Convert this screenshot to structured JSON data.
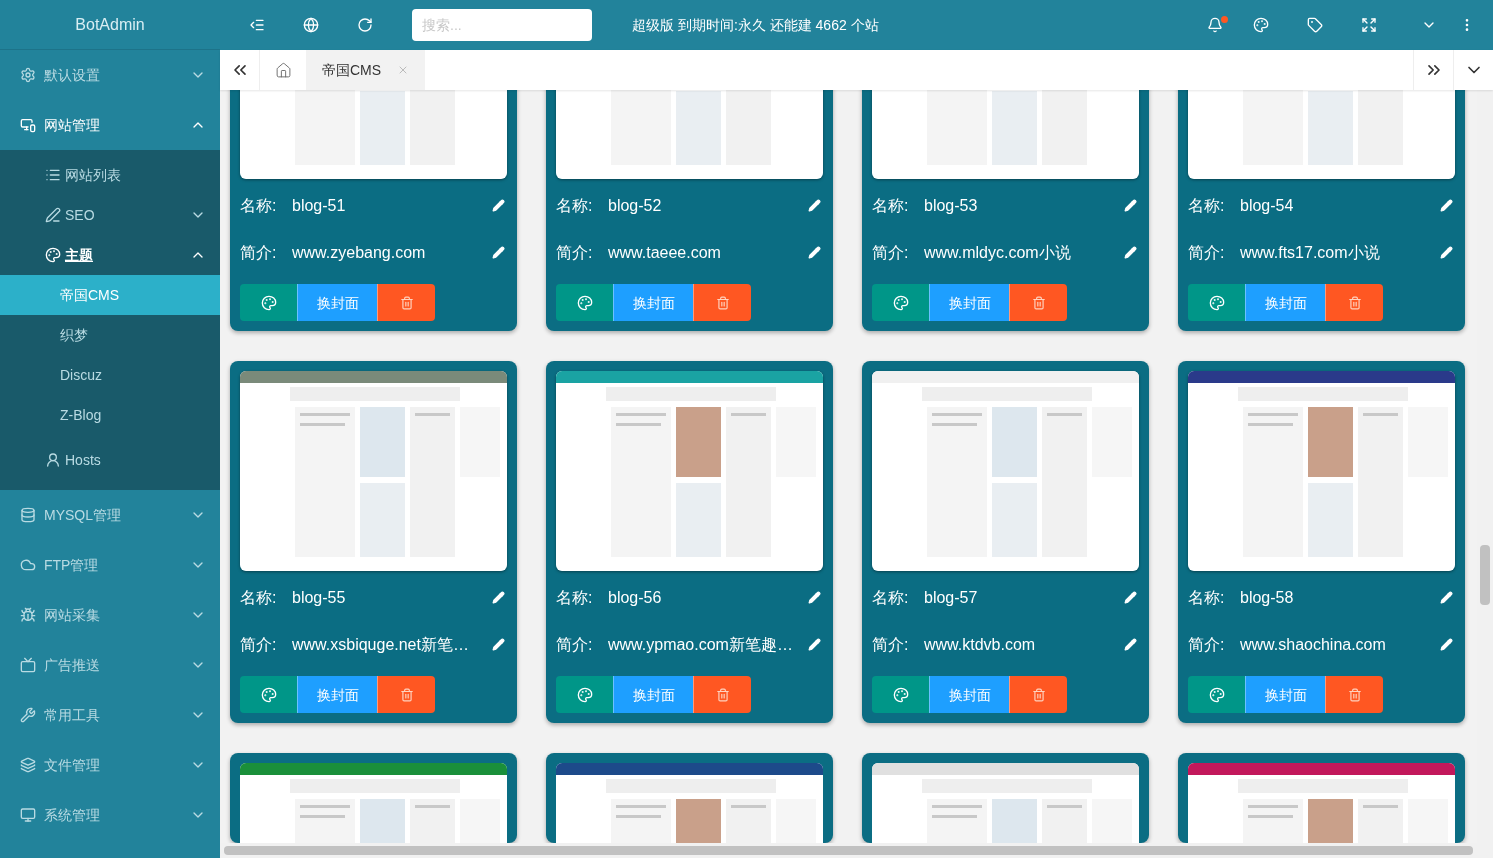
{
  "brand": "BotAdmin",
  "search": {
    "placeholder": "搜索..."
  },
  "notice": "超级版 到期时间:永久 还能建 4662 个站",
  "notifications": {
    "unread": true
  },
  "sidebar": {
    "items": [
      {
        "label": "默认设置",
        "expanded": false,
        "selected": false
      },
      {
        "label": "网站管理",
        "expanded": true,
        "selected": false,
        "children": [
          {
            "label": "网站列表",
            "selected": false
          },
          {
            "label": "SEO",
            "expanded": false,
            "selected": false
          },
          {
            "label": "主题",
            "expanded": true,
            "selected": false,
            "children": [
              {
                "label": "帝国CMS",
                "selected": true
              },
              {
                "label": "织梦",
                "selected": false
              },
              {
                "label": "Discuz",
                "selected": false
              },
              {
                "label": "Z-Blog",
                "selected": false
              }
            ]
          },
          {
            "label": "Hosts",
            "selected": false
          }
        ]
      },
      {
        "label": "MYSQL管理",
        "expanded": false,
        "selected": false
      },
      {
        "label": "FTP管理",
        "expanded": false,
        "selected": false
      },
      {
        "label": "网站采集",
        "expanded": false,
        "selected": false
      },
      {
        "label": "广告推送",
        "expanded": false,
        "selected": false
      },
      {
        "label": "常用工具",
        "expanded": false,
        "selected": false
      },
      {
        "label": "文件管理",
        "expanded": false,
        "selected": false
      },
      {
        "label": "系统管理",
        "expanded": false,
        "selected": false
      }
    ]
  },
  "tabs": [
    {
      "label": "帝国CMS",
      "selected": true
    }
  ],
  "cards": [
    {
      "name_label": "名称:",
      "name": "blog-51",
      "intro_label": "简介:",
      "intro": "www.zyebang.com",
      "cover_button": "换封面"
    },
    {
      "name_label": "名称:",
      "name": "blog-52",
      "intro_label": "简介:",
      "intro": "www.taeee.com",
      "cover_button": "换封面"
    },
    {
      "name_label": "名称:",
      "name": "blog-53",
      "intro_label": "简介:",
      "intro": "www.mldyc.com小说",
      "cover_button": "换封面"
    },
    {
      "name_label": "名称:",
      "name": "blog-54",
      "intro_label": "简介:",
      "intro": "www.fts17.com小说",
      "cover_button": "换封面"
    },
    {
      "name_label": "名称:",
      "name": "blog-55",
      "intro_label": "简介:",
      "intro": "www.xsbiquge.net新笔…",
      "cover_button": "换封面"
    },
    {
      "name_label": "名称:",
      "name": "blog-56",
      "intro_label": "简介:",
      "intro": "www.ypmao.com新笔趣…",
      "cover_button": "换封面"
    },
    {
      "name_label": "名称:",
      "name": "blog-57",
      "intro_label": "简介:",
      "intro": "www.ktdvb.com",
      "cover_button": "换封面"
    },
    {
      "name_label": "名称:",
      "name": "blog-58",
      "intro_label": "简介:",
      "intro": "www.shaochina.com",
      "cover_button": "换封面"
    },
    {
      "kind": "picture"
    },
    {
      "kind": "picture"
    },
    {
      "kind": "picture"
    },
    {
      "kind": "picture"
    }
  ]
}
